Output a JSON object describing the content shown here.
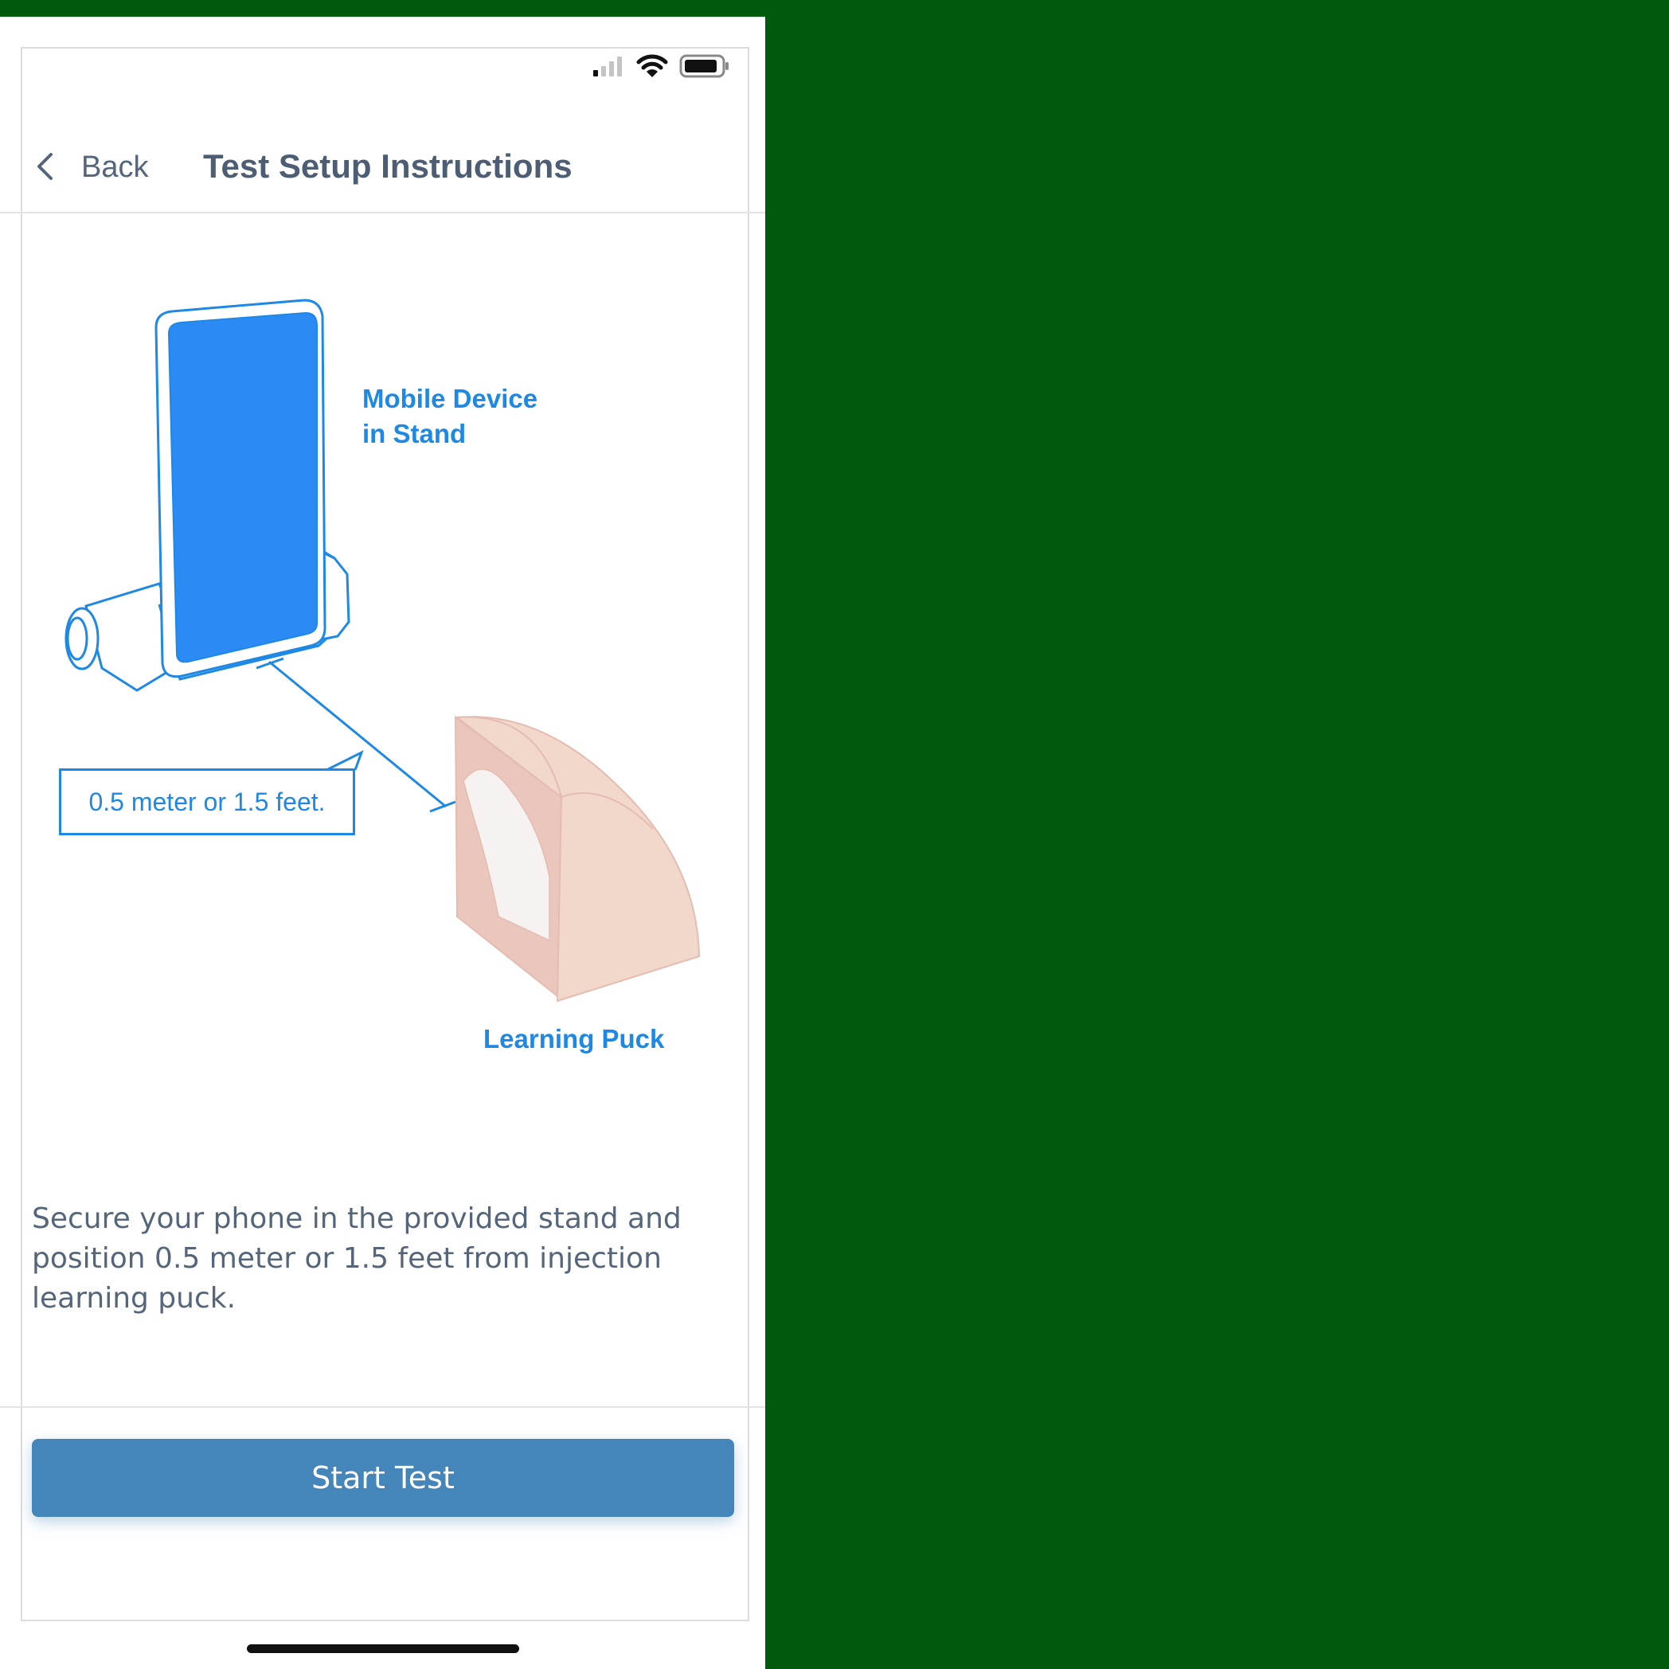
{
  "nav": {
    "back_label": "Back",
    "title": "Test Setup Instructions"
  },
  "illustration": {
    "device_label_line1": "Mobile Device",
    "device_label_line2": "in Stand",
    "distance_label": "0.5 meter or 1.5 feet.",
    "puck_label": "Learning Puck"
  },
  "description": "Secure your phone in the provided stand and position 0.5 meter or 1.5 feet from injection learning puck.",
  "start_button_label": "Start Test",
  "colors": {
    "background": "#005a0d",
    "accent_blue": "#1e88e5",
    "button": "#4485ba",
    "text": "#55657a",
    "puck": "#f1d6c9"
  },
  "icons": [
    "signal-icon",
    "wifi-icon",
    "battery-icon",
    "chevron-left-icon"
  ]
}
